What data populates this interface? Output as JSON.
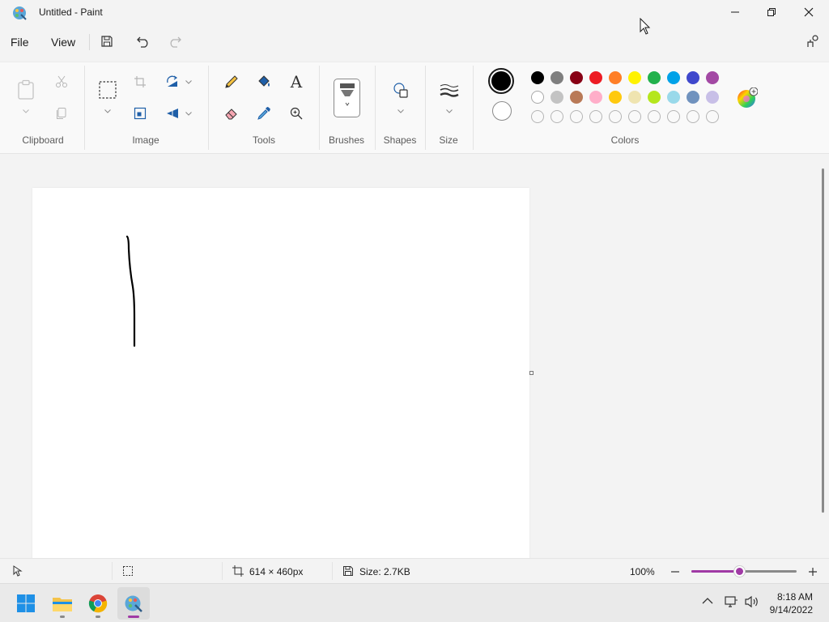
{
  "window": {
    "title": "Untitled - Paint",
    "app_icon": "paint-palette-icon",
    "controls": [
      "minimize-icon",
      "restore-icon",
      "close-icon"
    ]
  },
  "menu": {
    "file_label": "File",
    "view_label": "View",
    "quick_access": [
      "save-icon",
      "undo-icon",
      "redo-icon"
    ],
    "share_icon": "share-icon"
  },
  "ribbon": {
    "groups": {
      "clipboard": "Clipboard",
      "image": "Image",
      "tools": "Tools",
      "brushes": "Brushes",
      "shapes": "Shapes",
      "size": "Size",
      "colors": "Colors"
    },
    "clipboard_tools": [
      "paste-icon",
      "cut-icon",
      "copy-icon"
    ],
    "image_tools": [
      "select-icon",
      "crop-icon",
      "resize-icon",
      "rotate-icon",
      "flip-icon"
    ],
    "draw_tools": [
      "pencil-icon",
      "fill-icon",
      "text-icon",
      "eraser-icon",
      "color-picker-icon",
      "magnifier-icon"
    ],
    "text_tool_glyph": "A",
    "primary_color": "#000000",
    "secondary_color": "#ffffff",
    "palette_row1": [
      "#000000",
      "#7f7f7f",
      "#880015",
      "#ed1c24",
      "#ff7f27",
      "#fff200",
      "#22b14c",
      "#00a2e8",
      "#3f48cc",
      "#a349a4"
    ],
    "palette_row2": [
      "#ffffff",
      "#c3c3c3",
      "#b97a57",
      "#ffaec9",
      "#ffc90e",
      "#efe4b0",
      "#b5e61d",
      "#99d9ea",
      "#7092be",
      "#c8bfe7"
    ],
    "palette_row3_empty_count": 10,
    "edit_colors_icon": "color-wheel-icon"
  },
  "canvas": {
    "background": "#ffffff"
  },
  "status": {
    "cursor_icon": "cursor-position-icon",
    "selection_icon": "selection-size-icon",
    "canvas_size": "614 × 460px",
    "file_size": "Size: 2.7KB",
    "zoom": "100%",
    "zoom_fraction": 0.45
  },
  "taskbar": {
    "apps": [
      "windows-start-icon",
      "file-explorer-icon",
      "chrome-icon",
      "paint-app-icon"
    ],
    "time": "8:18 AM",
    "date": "9/14/2022",
    "tray": [
      "chevron-up-icon",
      "network-icon",
      "volume-icon"
    ]
  }
}
